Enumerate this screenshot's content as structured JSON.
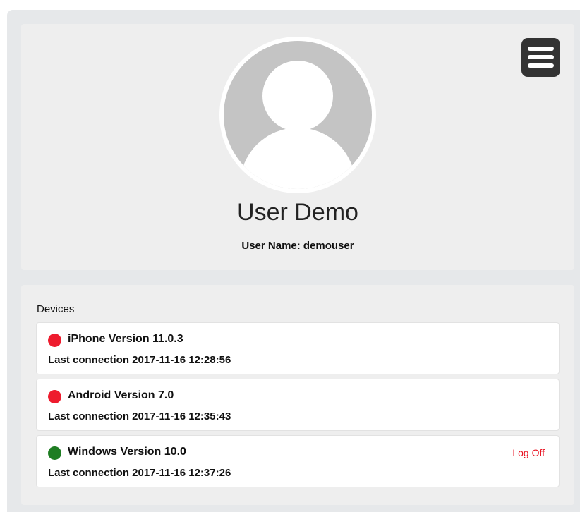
{
  "profile": {
    "display_name": "User Demo",
    "username_line": "User Name: demouser",
    "menu_icon": "hamburger-menu-icon",
    "avatar_icon": "default-user-avatar-icon"
  },
  "devices": {
    "heading": "Devices",
    "items": [
      {
        "name": "iPhone Version 11.0.3",
        "last_connection": "Last connection 2017-11-16 12:28:56",
        "status": "offline",
        "status_color": "#ee1c2e",
        "action": ""
      },
      {
        "name": "Android Version 7.0",
        "last_connection": "Last connection 2017-11-16 12:35:43",
        "status": "offline",
        "status_color": "#ee1c2e",
        "action": ""
      },
      {
        "name": "Windows Version 10.0",
        "last_connection": "Last connection 2017-11-16 12:37:26",
        "status": "online",
        "status_color": "#1e7d22",
        "action": "Log Off"
      }
    ]
  }
}
